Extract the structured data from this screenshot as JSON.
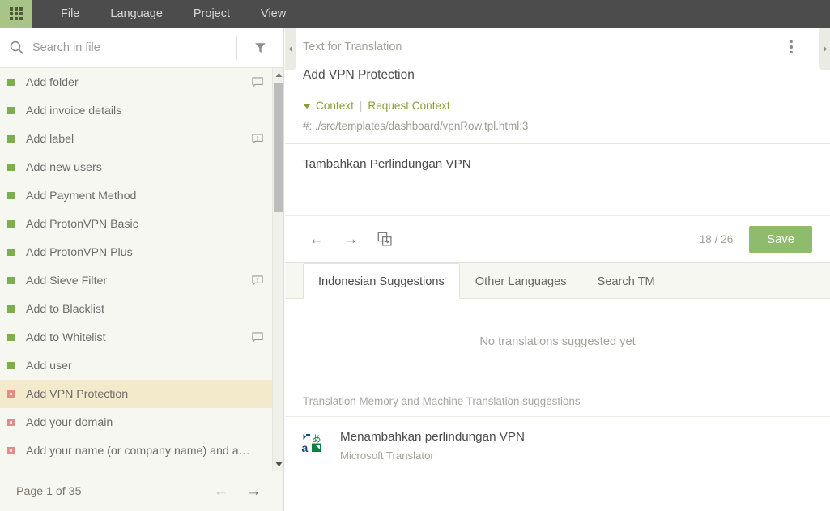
{
  "menubar": {
    "logo_icon": "apps-grid-icon",
    "items": [
      {
        "label": "File"
      },
      {
        "label": "Language"
      },
      {
        "label": "Project"
      },
      {
        "label": "View"
      }
    ]
  },
  "sidebar": {
    "search": {
      "placeholder": "Search in file",
      "value": "",
      "icon": "search-icon"
    },
    "filter_icon": "filter-funnel-icon",
    "items": [
      {
        "label": "Add folder",
        "status": "translated",
        "icon": "comment-icon"
      },
      {
        "label": "Add invoice details",
        "status": "translated",
        "icon": ""
      },
      {
        "label": "Add label",
        "status": "translated",
        "icon": "comment-alert-icon"
      },
      {
        "label": "Add new users",
        "status": "translated",
        "icon": ""
      },
      {
        "label": "Add Payment Method",
        "status": "translated",
        "icon": ""
      },
      {
        "label": "Add ProtonVPN Basic",
        "status": "translated",
        "icon": ""
      },
      {
        "label": "Add ProtonVPN Plus",
        "status": "translated",
        "icon": ""
      },
      {
        "label": "Add Sieve Filter",
        "status": "translated",
        "icon": "comment-alert-icon"
      },
      {
        "label": "Add to Blacklist",
        "status": "translated",
        "icon": ""
      },
      {
        "label": "Add to Whitelist",
        "status": "translated",
        "icon": "comment-icon"
      },
      {
        "label": "Add user",
        "status": "translated",
        "icon": ""
      },
      {
        "label": "Add VPN Protection",
        "status": "untranslated",
        "icon": "",
        "selected": true
      },
      {
        "label": "Add your domain",
        "status": "untranslated",
        "icon": ""
      },
      {
        "label": "Add your name (or company name) and addre…",
        "status": "untranslated",
        "icon": ""
      }
    ],
    "pager": {
      "text": "Page 1 of 35",
      "prev_icon": "arrow-left-icon",
      "next_icon": "arrow-right-icon"
    },
    "scrollbar": {
      "up_icon": "scroll-up-icon",
      "down_icon": "scroll-down-icon"
    }
  },
  "collapse": {
    "left_icon": "collapse-left-icon",
    "right_icon": "collapse-right-icon"
  },
  "main": {
    "header": {
      "title": "Text for Translation",
      "menu_icon": "kebab-menu-icon"
    },
    "source_text": "Add VPN Protection",
    "context": {
      "toggle_label": "Context",
      "request_label": "Request Context",
      "path": "#: ./src/templates/dashboard/vpnRow.tpl.html:3"
    },
    "target_text": "Tambahkan Perlindungan VPN",
    "toolbar": {
      "prev_icon": "arrow-left-icon",
      "next_icon": "arrow-right-icon",
      "copy_source_icon": "copy-source-icon",
      "counter": "18 / 26",
      "save_label": "Save"
    },
    "tabs": [
      {
        "label": "Indonesian Suggestions",
        "active": true
      },
      {
        "label": "Other Languages",
        "active": false
      },
      {
        "label": "Search TM",
        "active": false
      }
    ],
    "empty_message": "No translations suggested yet",
    "suggestions_header": "Translation Memory and Machine Translation suggestions",
    "suggestions": [
      {
        "text": "Menambahkan perlindungan VPN",
        "source": "Microsoft Translator",
        "icon": "microsoft-translator-icon"
      }
    ]
  },
  "colors": {
    "accent_green": "#8fbc6c",
    "link_olive": "#8a9e37",
    "menubar_dark": "#4c4c4c",
    "logo_green": "#a8c487",
    "selected_row": "#f3eacb",
    "status_translated": "#7cae4b",
    "status_untranslated": "#e58989"
  }
}
